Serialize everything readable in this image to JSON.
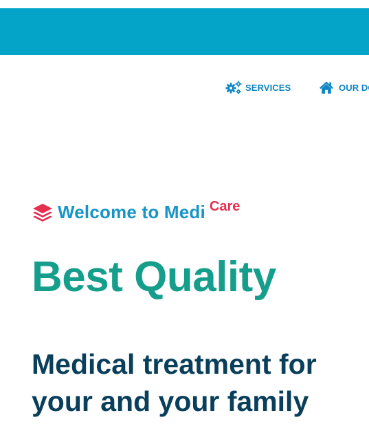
{
  "nav": {
    "items": [
      {
        "label": "SERVICES",
        "icon": "gears-icon"
      },
      {
        "label": "OUR DOCTORS",
        "icon": "home-icon"
      }
    ]
  },
  "hero": {
    "welcome_text": "Welcome to Medi",
    "welcome_superscript": "Care",
    "welcome_icon": "layers-icon",
    "headline": "Best Quality",
    "subline_1": "Medical treatment for",
    "subline_2": "your and your family"
  },
  "colors": {
    "top_bar": "#04a4c9",
    "nav_text": "#0e85c4",
    "welcome_text": "#1795c9",
    "care_accent": "#e62e4e",
    "headline": "#169e8c",
    "subline": "#093f5b"
  }
}
